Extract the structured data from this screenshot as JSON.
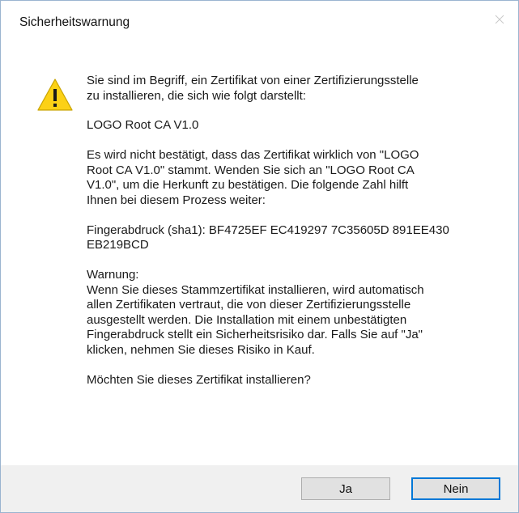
{
  "dialog": {
    "title": "Sicherheitswarnung",
    "close_icon": "close-icon",
    "warning_icon": "warning-triangle-icon"
  },
  "message": {
    "intro": "Sie sind im Begriff, ein Zertifikat von einer Zertifizierungsstelle\nzu installieren, die sich wie folgt darstellt:",
    "ca_name": "LOGO Root CA V1.0",
    "not_confirmed": "Es wird nicht bestätigt, dass das Zertifikat wirklich von \"LOGO\nRoot CA V1.0\" stammt. Wenden Sie sich an \"LOGO Root CA\nV1.0\", um die Herkunft zu bestätigen. Die folgende Zahl hilft\nIhnen bei diesem Prozess weiter:",
    "fingerprint": "Fingerabdruck (sha1): BF4725EF EC419297 7C35605D 891EE430\nEB219BCD",
    "warning": "Warnung:\nWenn Sie dieses Stammzertifikat installieren, wird automatisch\nallen Zertifikaten vertraut, die von dieser Zertifizierungsstelle\nausgestellt werden. Die Installation mit einem unbestätigten\nFingerabdruck stellt ein Sicherheitsrisiko dar. Falls Sie auf \"Ja\"\nklicken, nehmen Sie dieses Risiko in Kauf.",
    "question": "Möchten Sie dieses Zertifikat installieren?"
  },
  "buttons": {
    "yes_label": "Ja",
    "no_label": "Nein"
  },
  "colors": {
    "focus_border": "#0078d7",
    "warning_fill": "#fcd116",
    "footer_bg": "#f0f0f0"
  }
}
